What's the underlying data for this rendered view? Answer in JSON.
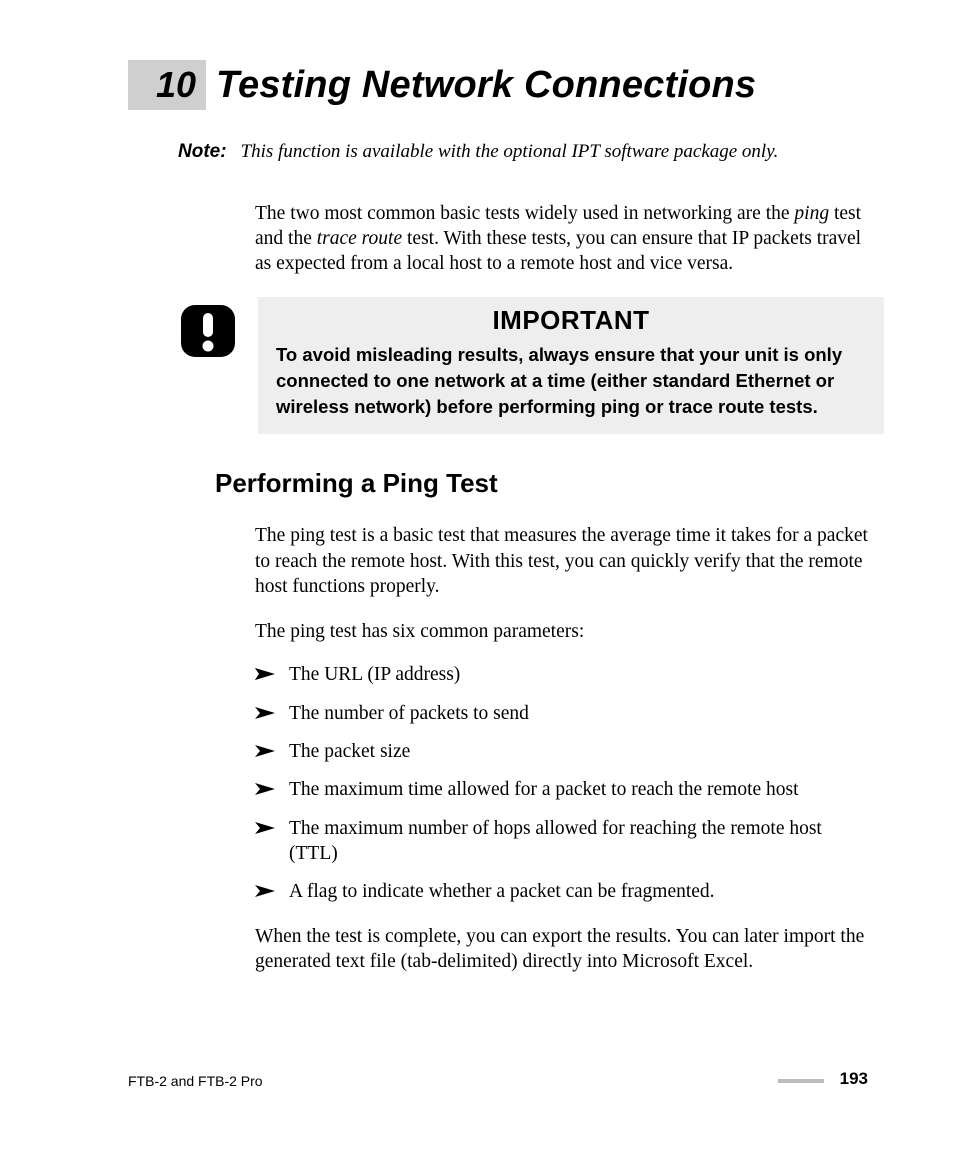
{
  "chapter": {
    "number": "10",
    "title": "Testing Network Connections"
  },
  "note": {
    "label": "Note:",
    "text": "This function is available with the optional IPT software package only."
  },
  "intro": {
    "pre": "The two most common basic tests widely used in networking are the ",
    "em1": "ping",
    "mid1": " test and the ",
    "em2": "trace route",
    "post": " test. With these tests, you can ensure that IP packets travel as expected from a local host to a remote host and vice versa."
  },
  "callout": {
    "title": "IMPORTANT",
    "text": "To avoid misleading results, always ensure that your unit is only connected to one network at a time (either standard Ethernet or wireless network) before performing ping or trace route tests."
  },
  "section": {
    "heading": "Performing a Ping Test",
    "p1": "The ping test is a basic test that measures the average time it takes for a packet to reach the remote host. With this test, you can quickly verify that the remote host functions properly.",
    "p2": "The ping test has six common parameters:",
    "bullets": [
      "The URL (IP address)",
      "The number of packets to send",
      "The packet size",
      "The maximum time allowed for a packet to reach the remote host",
      "The maximum number of hops allowed for reaching the remote host (TTL)",
      "A flag to indicate whether a packet can be fragmented."
    ],
    "p3": "When the test is complete, you can export the results. You can later import the generated text file (tab-delimited) directly into Microsoft Excel."
  },
  "footer": {
    "product": "FTB-2 and FTB-2 Pro",
    "page": "193"
  }
}
